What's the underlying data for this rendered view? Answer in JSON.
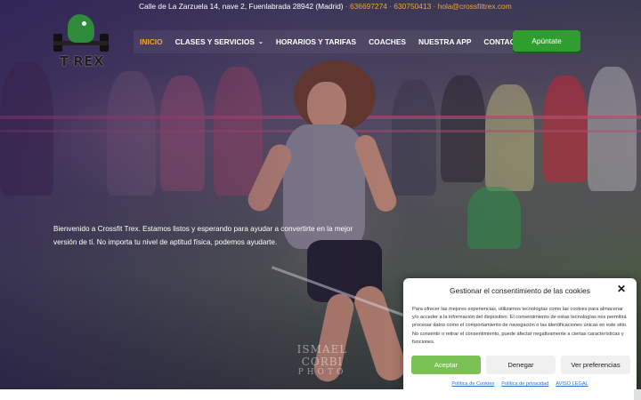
{
  "topbar": {
    "address": "Calle de La Zarzuela 14, nave 2, Fuenlabrada 28942 (Madrid)",
    "phones": "· 636697274 · 630750413 ·",
    "email": "hola@crossfittrex.com"
  },
  "logo": {
    "text": "T-REX",
    "icon": "trex-logo-icon"
  },
  "nav": {
    "items": [
      {
        "label": "INICIO",
        "active": true,
        "dropdown": false
      },
      {
        "label": "CLASES Y SERVICIOS",
        "active": false,
        "dropdown": true
      },
      {
        "label": "HORARIOS Y TARIFAS",
        "active": false,
        "dropdown": false
      },
      {
        "label": "COACHES",
        "active": false,
        "dropdown": false
      },
      {
        "label": "NUESTRA APP",
        "active": false,
        "dropdown": false
      },
      {
        "label": "CONTACTO",
        "active": false,
        "dropdown": true
      }
    ],
    "cta_label": "Apúntate",
    "accent_color": "#f2a33a",
    "cta_color": "#2e9f2f"
  },
  "hero": {
    "intro": "Bienvenido a Crossfit Trex. Estamos listos y esperando para ayudar a convertirte en la mejor versión de ti. No importa tu nivel de aptitud física, podemos ayudarte.",
    "watermark_line1": "ISMAEL CORBI",
    "watermark_line2": "PHOTO"
  },
  "consent": {
    "title": "Gestionar el consentimiento de las cookies",
    "close_icon": "close-icon",
    "body": "Para ofrecer las mejores experiencias, utilizamos tecnologías como las cookies para almacenar y/o acceder a la información del dispositivo. El consentimiento de estas tecnologías nos permitirá procesar datos como el comportamiento de navegación o las identificaciones únicas en este sitio. No consentir o retirar el consentimiento, puede afectar negativamente a ciertas características y funciones.",
    "accept_label": "Aceptar",
    "deny_label": "Denegar",
    "prefs_label": "Ver preferencias",
    "links": [
      "Política de Cookies",
      "Política de privacidad",
      "AVISO LEGAL"
    ],
    "accept_color": "#79c153"
  }
}
